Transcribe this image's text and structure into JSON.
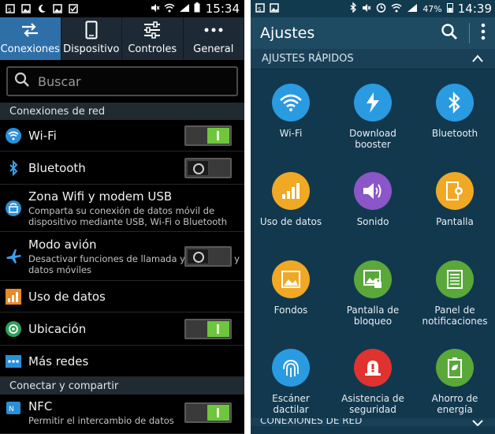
{
  "left": {
    "status_time": "15:34",
    "tabs": [
      {
        "label": "Conexiones",
        "icon": "arrows-exchange-icon"
      },
      {
        "label": "Dispositivo",
        "icon": "phone-device-icon"
      },
      {
        "label": "Controles",
        "icon": "sliders-icon"
      },
      {
        "label": "General",
        "icon": "more-dots-icon"
      }
    ],
    "search_placeholder": "Buscar",
    "section_network": "Conexiones de red",
    "section_share": "Conectar y compartir",
    "items": [
      {
        "title": "Wi-Fi",
        "toggle": "on"
      },
      {
        "title": "Bluetooth",
        "toggle": "off"
      },
      {
        "title": "Zona Wifi y modem USB",
        "subtitle": "Comparta su conexión de datos móvil de dispositivo mediante USB, Wi-Fi o Bluetooth"
      },
      {
        "title": "Modo avión",
        "subtitle": "Desactivar funciones de llamada y mensajes y datos móviles",
        "toggle": "off"
      },
      {
        "title": "Uso de datos"
      },
      {
        "title": "Ubicación",
        "toggle": "on"
      },
      {
        "title": "Más redes"
      },
      {
        "title": "NFC",
        "subtitle": "Permitir el intercambio de datos",
        "toggle": "on"
      }
    ]
  },
  "right": {
    "status_battery": "47%",
    "status_time": "14:39",
    "title": "Ajustes",
    "quick_header": "AJUSTES RÁPIDOS",
    "tiles": [
      {
        "label": "Wi-Fi",
        "color": "#2a9be0",
        "icon": "wifi-icon"
      },
      {
        "label": "Download\nbooster",
        "color": "#2a9be0",
        "icon": "download-booster-icon"
      },
      {
        "label": "Bluetooth",
        "color": "#2a9be0",
        "icon": "bluetooth-icon"
      },
      {
        "label": "Uso de datos",
        "color": "#f0a825",
        "icon": "data-usage-icon"
      },
      {
        "label": "Sonido",
        "color": "#8a56c8",
        "icon": "sound-icon"
      },
      {
        "label": "Pantalla",
        "color": "#f0a825",
        "icon": "display-icon"
      },
      {
        "label": "Fondos",
        "color": "#f0a825",
        "icon": "wallpaper-icon"
      },
      {
        "label": "Pantalla de\nbloqueo",
        "color": "#5aa83a",
        "icon": "lock-screen-icon"
      },
      {
        "label": "Panel de\nnotificaciones",
        "color": "#5aa83a",
        "icon": "notification-panel-icon"
      },
      {
        "label": "Escáner\ndactilar",
        "color": "#2a9be0",
        "icon": "fingerprint-icon"
      },
      {
        "label": "Asistencia de\nseguridad",
        "color": "#e0332f",
        "icon": "safety-assistance-icon"
      },
      {
        "label": "Ahorro de\nenergía",
        "color": "#5aa83a",
        "icon": "power-saving-icon"
      }
    ],
    "bottom_header": "CONEXIONES DE RED"
  }
}
